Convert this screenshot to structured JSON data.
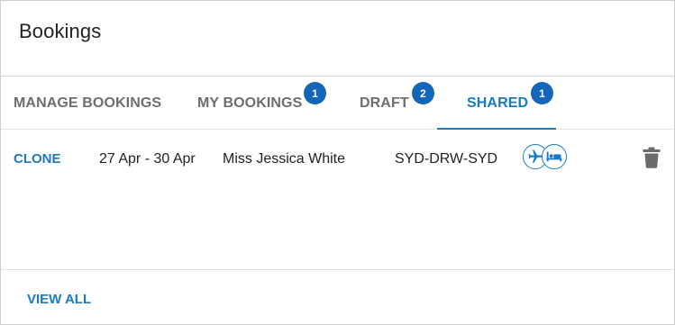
{
  "panel": {
    "title": "Bookings"
  },
  "tabs": [
    {
      "label": "MANAGE BOOKINGS",
      "badge": null
    },
    {
      "label": "MY BOOKINGS",
      "badge": "1"
    },
    {
      "label": "DRAFT",
      "badge": "2"
    },
    {
      "label": "SHARED",
      "badge": "1",
      "active": true
    }
  ],
  "booking": {
    "action": "CLONE",
    "dates": "27 Apr - 30 Apr",
    "traveller": "Miss Jessica White",
    "route": "SYD-DRW-SYD",
    "service_icons": [
      "flight-icon",
      "hotel-bed-icon"
    ],
    "delete_icon": "trash-icon"
  },
  "footer": {
    "view_all": "VIEW ALL"
  },
  "colors": {
    "accent": "#1a7bbf",
    "badge": "#1366b8",
    "tab_inactive": "#6e6e6e",
    "icon_gray": "#6b6b6b"
  }
}
